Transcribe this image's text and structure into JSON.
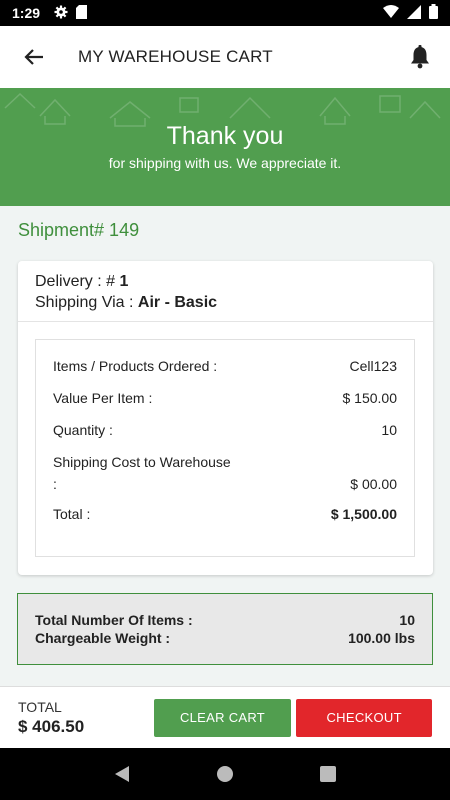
{
  "status_bar": {
    "time": "1:29",
    "icons": [
      "gear-icon",
      "sd-card-icon",
      "wifi-icon",
      "signal-icon",
      "battery-icon"
    ]
  },
  "app_bar": {
    "title": "MY WAREHOUSE CART",
    "back_icon": "arrow-left-icon",
    "bell_icon": "bell-icon"
  },
  "banner": {
    "heading": "Thank you",
    "subtext": "for shipping with us. We appreciate it."
  },
  "shipment": {
    "title": "Shipment# 149",
    "delivery_label": "Delivery : # ",
    "delivery_value": "1",
    "shipping_label": "Shipping Via : ",
    "shipping_value": "Air - Basic",
    "items_label": "Items / Products Ordered :",
    "items_value": "Cell123",
    "value_label": "Value Per Item :",
    "value_value": "$ 150.00",
    "qty_label": "Quantity :",
    "qty_value": "10",
    "ship_cost_label": "Shipping Cost to Warehouse",
    "ship_cost_colon": ":",
    "ship_cost_value": "$ 00.00",
    "total_label": "Total :",
    "total_value": "$ 1,500.00"
  },
  "summary": {
    "items_label": "Total Number Of Items :",
    "items_value": "10",
    "weight_label": "Chargeable Weight :",
    "weight_value": "100.00 lbs"
  },
  "footer": {
    "total_label": "TOTAL",
    "total_amount": "$ 406.50",
    "clear_label": "CLEAR CART",
    "checkout_label": "CHECKOUT"
  },
  "colors": {
    "brand_green": "#519e4f",
    "checkout_red": "#e2262b"
  }
}
